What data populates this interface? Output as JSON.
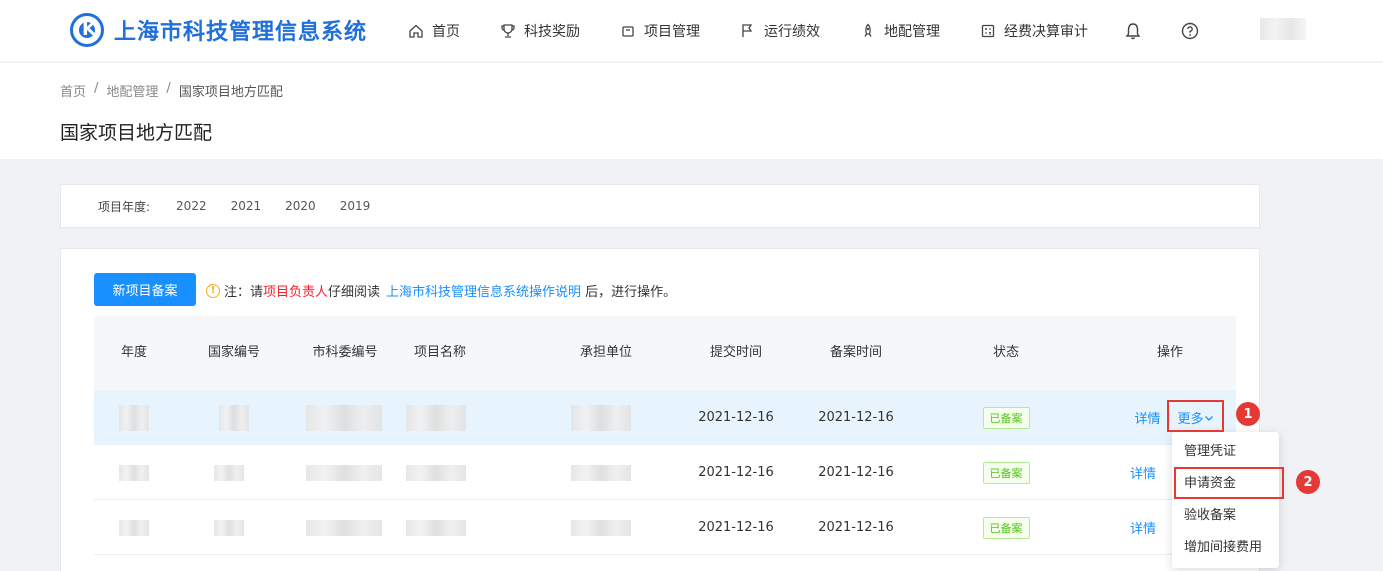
{
  "app": {
    "title": "上海市科技管理信息系统",
    "logo_letter": "K"
  },
  "nav": [
    {
      "label": "首页",
      "icon": "home-icon"
    },
    {
      "label": "科技奖励",
      "icon": "trophy-icon"
    },
    {
      "label": "项目管理",
      "icon": "folder-icon"
    },
    {
      "label": "运行绩效",
      "icon": "flag-icon"
    },
    {
      "label": "地配管理",
      "icon": "rocket-icon"
    },
    {
      "label": "经费决算审计",
      "icon": "calculator-icon"
    }
  ],
  "header_icons": {
    "bell": "bell-icon",
    "help": "help-icon"
  },
  "breadcrumb": {
    "home": "首页",
    "sep": "/",
    "parent": "地配管理",
    "current": "国家项目地方匹配"
  },
  "page_title": "国家项目地方匹配",
  "filter": {
    "label": "项目年度:",
    "years": [
      "2022",
      "2021",
      "2020",
      "2019"
    ]
  },
  "actions": {
    "new_button": "新项目备案"
  },
  "notice": {
    "prefix": "注：请",
    "highlight": "项目负责人",
    "middle": "仔细阅读",
    "link": "上海市科技管理信息系统操作说明",
    "suffix": "后，进行操作。"
  },
  "table": {
    "headers": [
      "年度",
      "国家编号",
      "市科委编号",
      "项目名称",
      "承担单位",
      "提交时间",
      "备案时间",
      "状态",
      "操作"
    ],
    "rows": [
      {
        "submit_time": "2021-12-16",
        "record_time": "2021-12-16",
        "status": "已备案",
        "detail": "详情",
        "more": "更多"
      },
      {
        "submit_time": "2021-12-16",
        "record_time": "2021-12-16",
        "status": "已备案",
        "detail": "详情"
      },
      {
        "submit_time": "2021-12-16",
        "record_time": "2021-12-16",
        "status": "已备案",
        "detail": "详情"
      }
    ]
  },
  "dropdown": {
    "items": [
      "管理凭证",
      "申请资金",
      "验收备案",
      "增加间接费用"
    ]
  },
  "markers": [
    "1",
    "2"
  ],
  "colors": {
    "primary": "#1890ff",
    "brand": "#1f6fdc",
    "highlight": "#e53935",
    "success": "#52c41a"
  }
}
